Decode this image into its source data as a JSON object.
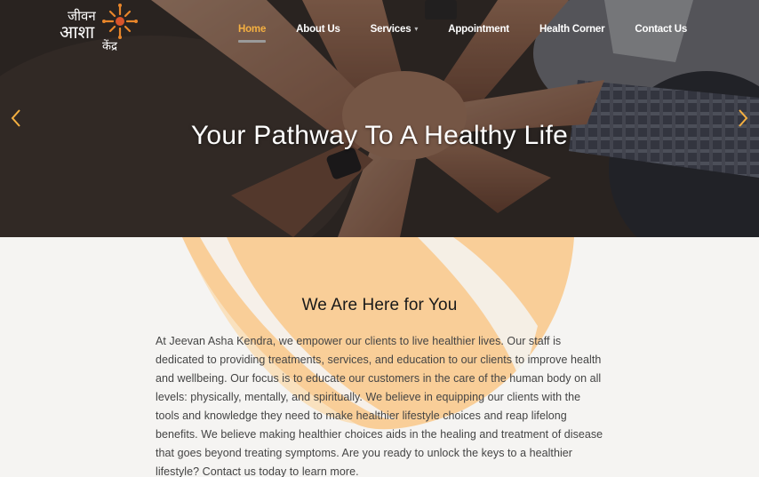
{
  "logo": {
    "line1": "जीवन",
    "line2": "आशा",
    "line3": "केंद्र",
    "accent_color": "#e8862a"
  },
  "nav": {
    "items": [
      {
        "label": "Home",
        "active": true
      },
      {
        "label": "About Us",
        "active": false
      },
      {
        "label": "Services",
        "active": false,
        "has_dropdown": true
      },
      {
        "label": "Appointment",
        "active": false
      },
      {
        "label": "Health Corner",
        "active": false
      },
      {
        "label": "Contact Us",
        "active": false
      }
    ],
    "active_color": "#f5b041"
  },
  "hero": {
    "title": "Your Pathway To A Healthy Life",
    "prev_icon": "chevron-left-icon",
    "next_icon": "chevron-right-icon",
    "arrow_color": "#f5b041"
  },
  "intro": {
    "title": "We Are Here for You",
    "body": "At Jeevan Asha Kendra, we empower our clients to live healthier lives. Our staff is dedicated to providing treatments, services, and education to our clients to improve health and wellbeing. Our focus is to educate our customers in the care of the human body on all levels: physically, mentally, and spiritually. We believe in equipping our clients with the tools and knowledge they need to make healthier lifestyle choices and reap lifelong benefits. We believe making healthier choices aids in the healing and treatment of disease that goes beyond treating symptoms. Are you ready to unlock the keys to a healthier lifestyle? Contact us today to learn more."
  }
}
